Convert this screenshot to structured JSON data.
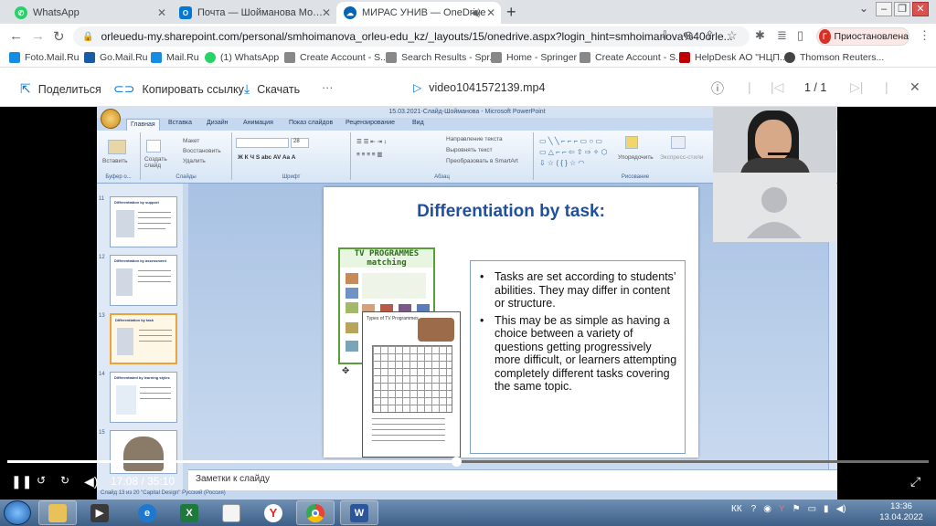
{
  "browser": {
    "tabs": [
      {
        "label": "WhatsApp",
        "icon": "whatsapp-icon",
        "color": "#25d366",
        "active": false
      },
      {
        "label": "Почта — Шойманова Молдир Е",
        "icon": "outlook-icon",
        "color": "#0078d4",
        "active": false
      },
      {
        "label": "МИРАС УНИВ — OneDrive",
        "icon": "onedrive-icon",
        "color": "#0364b8",
        "active": true
      }
    ],
    "new_tab": "+",
    "url": "orleuedu-my.sharepoint.com/personal/smhoimanova_orleu-edu_kz/_layouts/15/onedrive.aspx?login_hint=smhoimanova%40orle...",
    "profile_initial": "Г",
    "profile_label": "Приостановлена",
    "bookmarks": [
      {
        "label": "Foto.Mail.Ru",
        "color": "#168de2"
      },
      {
        "label": "Go.Mail.Ru",
        "color": "#1a5ba6"
      },
      {
        "label": "Mail.Ru",
        "color": "#168de2"
      },
      {
        "label": "(1) WhatsApp",
        "color": "#25d366"
      },
      {
        "label": "Create Account - S...",
        "color": "#888888"
      },
      {
        "label": "Search Results - Spr...",
        "color": "#888888"
      },
      {
        "label": "Home - Springer",
        "color": "#888888"
      },
      {
        "label": "Create Account - S...",
        "color": "#888888"
      },
      {
        "label": "HelpDesk АО \"НЦП...",
        "color": "#c00000"
      },
      {
        "label": "Thomson Reuters...",
        "color": "#444444"
      }
    ]
  },
  "onedrive": {
    "share_label": "Поделиться",
    "copy_link_label": "Копировать ссылку",
    "download_label": "Скачать",
    "more_label": "···",
    "file_name": "video1041572139.mp4",
    "page_count": "1 / 1",
    "close_label": "✕"
  },
  "powerpoint": {
    "window_title": "15.03.2021-Слайд-Шойманова - Microsoft PowerPoint",
    "ribbon_tabs": [
      "Главная",
      "Вставка",
      "Дизайн",
      "Анимация",
      "Показ слайдов",
      "Рецензирование",
      "Вид"
    ],
    "groups": [
      "Буфер о...",
      "Слайды",
      "Шрифт",
      "Абзац",
      "Рисование"
    ],
    "buttons": {
      "paste": "Вставить",
      "new_slide": "Создать слайд",
      "layout": "Макет",
      "reset": "Восстановить",
      "delete": "Удалить",
      "text_direction": "Направление текста",
      "align_text": "Выровнять текст",
      "smartart": "Преобразовать в SmartArt",
      "arrange": "Упорядочить",
      "quick_styles": "Экспресс-стили"
    },
    "font_size": "28",
    "thumbnails": [
      {
        "number": "11",
        "title": "Differentiation by support"
      },
      {
        "number": "12",
        "title": "Differentiation by assessment"
      },
      {
        "number": "13",
        "title": "Differentiation by task",
        "selected": true
      },
      {
        "number": "14",
        "title": "Differentiated by learning styles"
      },
      {
        "number": "15",
        "title": ""
      }
    ],
    "notes_placeholder": "Заметки к слайду",
    "status": "Слайд 13 из 20    \"Capital Design\"    Русский (Россия)"
  },
  "slide": {
    "title": "Differentiation by task:",
    "worksheet1_title": "TV PROGRAMMES matching",
    "worksheet2_title": "Types of TV Programmes",
    "bullets": [
      "Tasks are set according to students’ abilities. They may differ in content or structure.",
      "This may be as simple as having a choice between a variety of questions getting progressively more difficult, or learners attempting completely different tasks covering the same topic."
    ]
  },
  "player": {
    "current_time": "17:08",
    "separator": "/",
    "duration": "35:10",
    "progress_fraction": 0.487
  },
  "taskbar": {
    "apps": [
      {
        "name": "explorer",
        "letter": "",
        "color": "#e8c15a",
        "open": true
      },
      {
        "name": "ie",
        "letter": "e",
        "color": "#1e78d2",
        "open": false
      },
      {
        "name": "excel",
        "letter": "X",
        "color": "#1d7a3a",
        "open": false
      },
      {
        "name": "notepad",
        "letter": "",
        "color": "#f4f4f4",
        "open": false
      },
      {
        "name": "yandex",
        "letter": "Y",
        "color": "#e52620",
        "open": false
      },
      {
        "name": "chrome",
        "letter": "",
        "color": "#ffffff",
        "open": true
      },
      {
        "name": "word",
        "letter": "W",
        "color": "#2b579a",
        "open": true
      }
    ],
    "language": "КК",
    "time": "13:36",
    "date": "13.04.2022"
  }
}
